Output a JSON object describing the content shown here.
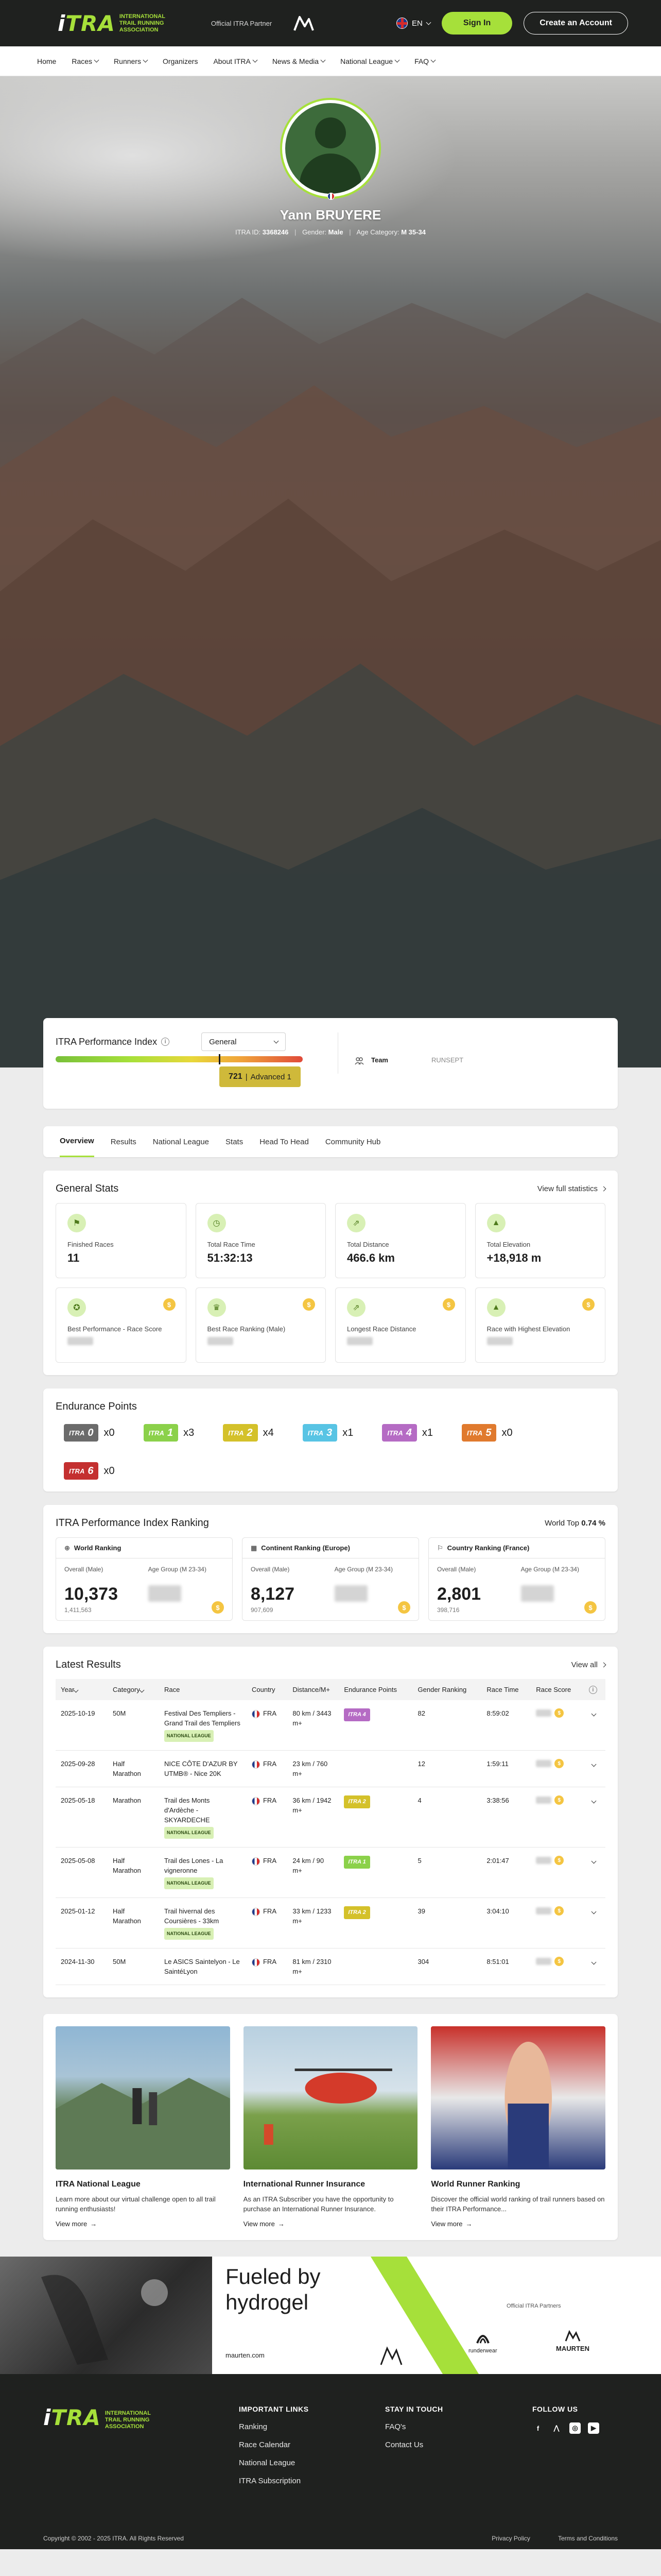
{
  "header": {
    "logo_text_white": "i",
    "logo_text_accent": "TRA",
    "logo_subtitle": "INTERNATIONAL TRAIL RUNNING ASSOCIATION",
    "partner_label": "Official ITRA Partner",
    "language": "EN",
    "signin_label": "Sign In",
    "create_label": "Create an Account"
  },
  "nav": {
    "items": [
      "Home",
      "Races",
      "Runners",
      "Organizers",
      "About ITRA",
      "News & Media",
      "National League",
      "FAQ"
    ]
  },
  "profile": {
    "name": "Yann BRUYERE",
    "itra_id_label": "ITRA ID:",
    "itra_id": "3368246",
    "gender_label": "Gender:",
    "gender": "Male",
    "age_label": "Age Category:",
    "age_category": "M 35-34"
  },
  "performance": {
    "title": "ITRA Performance Index",
    "select_value": "General",
    "score": "721",
    "level": "Advanced 1",
    "score_fraction": 0.66,
    "team_label": "Team",
    "team_value": "RUNSEPT"
  },
  "tabs": [
    "Overview",
    "Results",
    "National League",
    "Stats",
    "Head To Head",
    "Community Hub"
  ],
  "general_stats": {
    "title": "General Stats",
    "view_full": "View full statistics",
    "items": [
      {
        "label": "Finished Races",
        "value": "11",
        "icon": "flag-icon"
      },
      {
        "label": "Total Race Time",
        "value": "51:32:13",
        "icon": "clock-icon"
      },
      {
        "label": "Total Distance",
        "value": "466.6 km",
        "icon": "distance-icon"
      },
      {
        "label": "Total Elevation",
        "value": "+18,918 m",
        "icon": "elevation-icon"
      },
      {
        "label": "Best Performance - Race Score",
        "value": "",
        "icon": "medal-icon"
      },
      {
        "label": "Best Race Ranking (Male)",
        "value": "",
        "icon": "ranking-icon"
      },
      {
        "label": "Longest Race Distance",
        "value": "",
        "icon": "distance-icon"
      },
      {
        "label": "Race with Highest Elevation",
        "value": "",
        "icon": "elevation-icon"
      }
    ]
  },
  "endurance": {
    "title": "Endurance Points",
    "items": [
      {
        "level": "0",
        "count": "x0",
        "color": "#6b6b6b"
      },
      {
        "level": "1",
        "count": "x3",
        "color": "#8bd14a"
      },
      {
        "level": "2",
        "count": "x4",
        "color": "#d4c12a"
      },
      {
        "level": "3",
        "count": "x1",
        "color": "#58c4e4"
      },
      {
        "level": "4",
        "count": "x1",
        "color": "#b56bc4"
      },
      {
        "level": "5",
        "count": "x0",
        "color": "#e07a2e"
      },
      {
        "level": "6",
        "count": "x0",
        "color": "#c43030"
      }
    ]
  },
  "ranking": {
    "title": "ITRA Performance Index Ranking",
    "world_top_label": "World Top",
    "world_top_value": "0.74 %",
    "overall_label": "Overall (Male)",
    "age_group_label": "Age Group (M 23-34)",
    "boxes": [
      {
        "title": "World Ranking",
        "overall": "10,373",
        "total": "1,411,563"
      },
      {
        "title": "Continent Ranking (Europe)",
        "overall": "8,127",
        "total": "907,609"
      },
      {
        "title": "Country Ranking (France)",
        "overall": "2,801",
        "total": "398,716"
      }
    ]
  },
  "results": {
    "title": "Latest Results",
    "view_all": "View all",
    "columns": [
      "Year",
      "Category",
      "Race",
      "Country",
      "Distance/M+",
      "Endurance Points",
      "Gender Ranking",
      "Race Time",
      "Race Score"
    ],
    "rows": [
      {
        "date": "2025-10-19",
        "category": "50M",
        "race": "Festival Des Templiers - Grand Trail des Templiers",
        "nl": "NATIONAL LEAGUE",
        "country": "FRA",
        "distance": "80 km / 3443 m+",
        "ep": "ITRA 4",
        "ep_color": "#b56bc4",
        "rank": "82",
        "time": "8:59:02"
      },
      {
        "date": "2025-09-28",
        "category": "Half Marathon",
        "race": "NICE CÔTE D'AZUR BY UTMB® - Nice 20K",
        "nl": "",
        "country": "FRA",
        "distance": "23 km / 760 m+",
        "ep": "",
        "ep_color": "",
        "rank": "12",
        "time": "1:59:11"
      },
      {
        "date": "2025-05-18",
        "category": "Marathon",
        "race": "Trail des Monts d'Ardèche - SKYARDECHE",
        "nl": "NATIONAL LEAGUE",
        "country": "FRA",
        "distance": "36 km / 1942 m+",
        "ep": "ITRA 2",
        "ep_color": "#d4c12a",
        "rank": "4",
        "time": "3:38:56"
      },
      {
        "date": "2025-05-08",
        "category": "Half Marathon",
        "race": "Trail des Lones - La vigneronne",
        "nl": "NATIONAL LEAGUE",
        "country": "FRA",
        "distance": "24 km / 90 m+",
        "ep": "ITRA 1",
        "ep_color": "#8bd14a",
        "rank": "5",
        "time": "2:01:47"
      },
      {
        "date": "2025-01-12",
        "category": "Half Marathon",
        "race": "Trail hivernal des Coursières - 33km",
        "nl": "NATIONAL LEAGUE",
        "country": "FRA",
        "distance": "33 km / 1233 m+",
        "ep": "ITRA 2",
        "ep_color": "#d4c12a",
        "rank": "39",
        "time": "3:04:10"
      },
      {
        "date": "2024-11-30",
        "category": "50M",
        "race": "Le ASICS Saintelyon - Le SaintéLyon",
        "nl": "",
        "country": "FRA",
        "distance": "81 km / 2310 m+",
        "ep": "",
        "ep_color": "",
        "rank": "304",
        "time": "8:51:01"
      }
    ]
  },
  "promos": [
    {
      "title": "ITRA National League",
      "desc": "Learn more about our virtual challenge open to all trail running enthusiasts!",
      "more": "View more"
    },
    {
      "title": "International Runner Insurance",
      "desc": "As an ITRA Subscriber you have the opportunity to purchase an International Runner Insurance.",
      "more": "View more"
    },
    {
      "title": "World Runner Ranking",
      "desc": "Discover the official world ranking of trail runners based on their ITRA Performance...",
      "more": "View more"
    }
  ],
  "banner": {
    "headline": "Fueled by hydrogel",
    "url": "maurten.com",
    "partners_label": "Official ITRA Partners",
    "partner_1": "runderwear",
    "partner_2": "MAURTEN"
  },
  "footer": {
    "important_title": "IMPORTANT LINKS",
    "important_links": [
      "Ranking",
      "Race Calendar",
      "National League",
      "ITRA Subscription"
    ],
    "touch_title": "STAY IN TOUCH",
    "touch_links": [
      "FAQ's",
      "Contact Us"
    ],
    "follow_title": "FOLLOW US",
    "copyright": "Copyright © 2002 - 2025 ITRA. All Rights Reserved",
    "privacy": "Privacy Policy",
    "terms": "Terms and Conditions"
  }
}
